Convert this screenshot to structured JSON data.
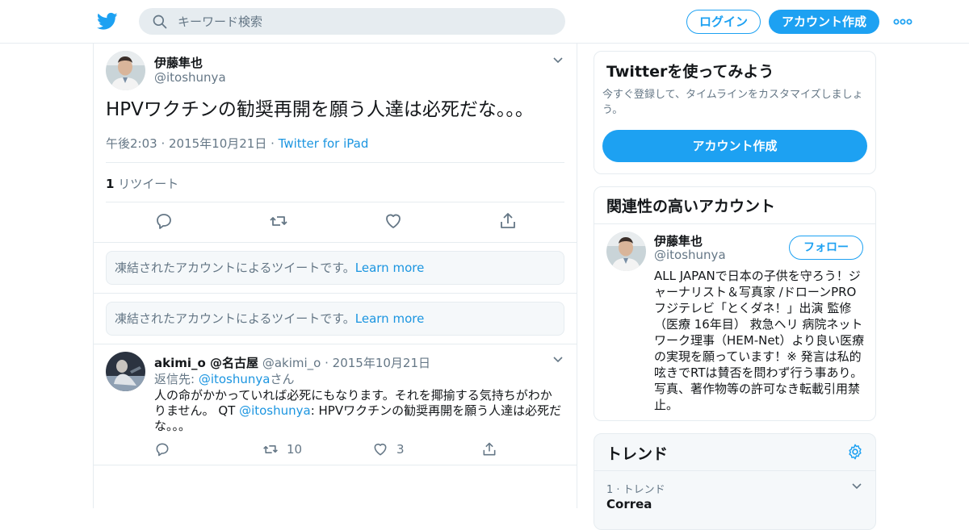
{
  "header": {
    "search_placeholder": "キーワード検索",
    "login_label": "ログイン",
    "signup_label": "アカウント作成"
  },
  "tweet": {
    "name": "伊藤隼也",
    "handle": "@itoshunya",
    "text": "HPVワクチンの勧奨再開を願う人達は必死だな。。。",
    "timestamp": "午後2:03 · 2015年10月21日",
    "source": "Twitter for iPad",
    "retweet_count": "1",
    "retweet_label": "リツイート"
  },
  "frozen_notices": [
    {
      "text": "凍結されたアカウントによるツイートです。",
      "link": "Learn more"
    },
    {
      "text": "凍結されたアカウントによるツイートです。",
      "link": "Learn more"
    }
  ],
  "reply": {
    "name": "akimi_o @名古屋",
    "handle": "@akimi_o",
    "date": "2015年10月21日",
    "reply_prefix": "返信先: ",
    "reply_to": "@itoshunya",
    "reply_suffix": "さん",
    "body_1": "人の命がかかっていれば必死にもなります。それを揶揄する気持ちがわかりません。 QT ",
    "body_mention": "@itoshunya",
    "body_2": ": HPVワクチンの勧奨再開を願う人達は必死だな。。。",
    "retweets": "10",
    "likes": "3"
  },
  "sidebar": {
    "signup_card": {
      "title": "Twitterを使ってみよう",
      "description": "今すぐ登録して、タイムラインをカスタマイズしましょう。",
      "button": "アカウント作成"
    },
    "related": {
      "title": "関連性の高いアカウント",
      "name": "伊藤隼也",
      "handle": "@itoshunya",
      "follow": "フォロー",
      "bio": "ALL JAPANで日本の子供を守ろう！ジャーナリスト＆写真家 /ドローンPRO フジテレビ「とくダネ！」出演 監修（医療 16年目） 救急ヘリ 病院ネットワーク理事（HEM-Net）より良い医療の実現を願っています！※ 発言は私的呟きでRTは賛否を問わず行う事あり。写真、著作物等の許可なき転載引用禁止。"
    },
    "trends": {
      "title": "トレンド",
      "items": [
        {
          "rank": "1 · トレンド",
          "name": "Correa"
        }
      ]
    }
  },
  "colors": {
    "accent": "#1da1f2",
    "link": "#1b95e0",
    "muted": "#657786",
    "border": "#e6ecf0"
  },
  "icons": {
    "logo": "twitter-bird-icon",
    "search": "search-icon",
    "more": "more-dots-icon",
    "reply": "reply-icon",
    "retweet": "retweet-icon",
    "like": "heart-icon",
    "share": "share-icon",
    "caret": "chevron-down-icon",
    "settings": "gear-icon"
  }
}
